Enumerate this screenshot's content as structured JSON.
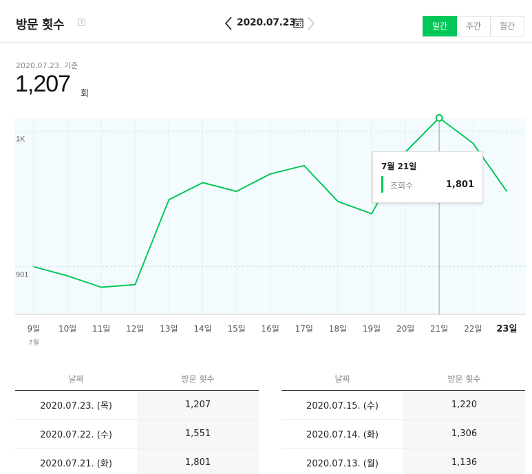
{
  "header": {
    "title": "방문 횟수",
    "help": "?",
    "date": "2020.07.23.",
    "periods": [
      "일간",
      "주간",
      "월간"
    ],
    "active_period": "일간"
  },
  "summary": {
    "ref_date": "2020.07.23. 기준",
    "total": "1,207",
    "unit": "회"
  },
  "tooltip": {
    "title": "7월 21일",
    "series_label": "조회수",
    "value": "1,801"
  },
  "colors": {
    "accent": "#03c75a",
    "plot_bg": "#f4fbfe"
  },
  "chart_data": {
    "type": "line",
    "categories": [
      "9일",
      "10일",
      "11일",
      "12일",
      "13일",
      "14일",
      "15일",
      "16일",
      "17일",
      "18일",
      "19일",
      "20일",
      "21일",
      "22일",
      "23일"
    ],
    "month_label": "7월",
    "series": [
      {
        "name": "조회수",
        "values": [
          901,
          880,
          854,
          860,
          1054,
          1093,
          1073,
          1113,
          1132,
          1050,
          1022,
          1163,
          1241,
          1183,
          1073
        ]
      }
    ],
    "y_ticks": [
      {
        "value": 901,
        "label": "901"
      },
      {
        "value": 1211,
        "label": "1K"
      }
    ],
    "ylim": [
      792,
      1240
    ],
    "highlight_index": 12,
    "bold_category_index": 14,
    "grid": true
  },
  "table": {
    "headers": [
      "날짜",
      "방문 횟수"
    ],
    "left": [
      [
        "2020.07.23. (목)",
        "1,207"
      ],
      [
        "2020.07.22. (수)",
        "1,551"
      ],
      [
        "2020.07.21. (화)",
        "1,801"
      ]
    ],
    "right": [
      [
        "2020.07.15. (수)",
        "1,220"
      ],
      [
        "2020.07.14. (화)",
        "1,306"
      ],
      [
        "2020.07.13. (월)",
        "1,136"
      ]
    ]
  }
}
